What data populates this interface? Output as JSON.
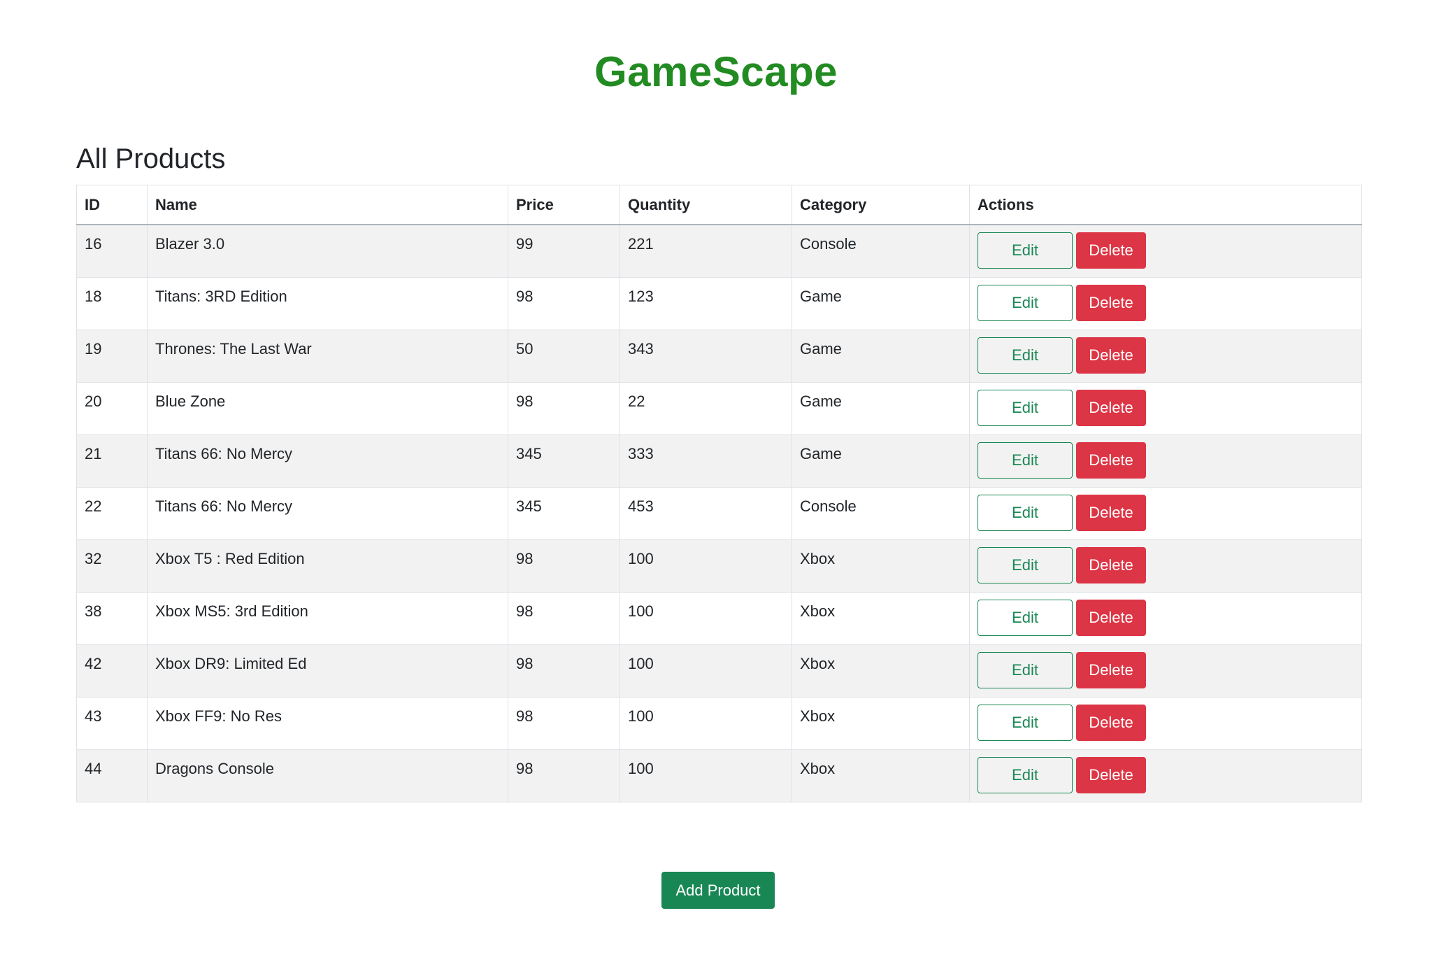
{
  "brand": {
    "title": "GameScape",
    "color": "#228b22"
  },
  "page": {
    "title": "All Products"
  },
  "table": {
    "headers": {
      "id": "ID",
      "name": "Name",
      "price": "Price",
      "quantity": "Quantity",
      "category": "Category",
      "actions": "Actions"
    },
    "edit_label": "Edit",
    "delete_label": "Delete",
    "rows": [
      {
        "id": "16",
        "name": "Blazer 3.0",
        "price": "99",
        "quantity": "221",
        "category": "Console"
      },
      {
        "id": "18",
        "name": "Titans: 3RD Edition",
        "price": "98",
        "quantity": "123",
        "category": "Game"
      },
      {
        "id": "19",
        "name": "Thrones: The Last War",
        "price": "50",
        "quantity": "343",
        "category": "Game"
      },
      {
        "id": "20",
        "name": "Blue Zone",
        "price": "98",
        "quantity": "22",
        "category": "Game"
      },
      {
        "id": "21",
        "name": "Titans 66: No Mercy",
        "price": "345",
        "quantity": "333",
        "category": "Game"
      },
      {
        "id": "22",
        "name": "Titans 66: No Mercy",
        "price": "345",
        "quantity": "453",
        "category": "Console"
      },
      {
        "id": "32",
        "name": "Xbox T5 : Red Edition",
        "price": "98",
        "quantity": "100",
        "category": "Xbox"
      },
      {
        "id": "38",
        "name": "Xbox MS5: 3rd Edition",
        "price": "98",
        "quantity": "100",
        "category": "Xbox"
      },
      {
        "id": "42",
        "name": "Xbox DR9: Limited Ed",
        "price": "98",
        "quantity": "100",
        "category": "Xbox"
      },
      {
        "id": "43",
        "name": "Xbox FF9: No Res",
        "price": "98",
        "quantity": "100",
        "category": "Xbox"
      },
      {
        "id": "44",
        "name": "Dragons Console",
        "price": "98",
        "quantity": "100",
        "category": "Xbox"
      }
    ]
  },
  "footer": {
    "add_label": "Add Product"
  },
  "colors": {
    "primary_green": "#198754",
    "danger_red": "#dc3545",
    "stripe": "#f2f2f2"
  }
}
